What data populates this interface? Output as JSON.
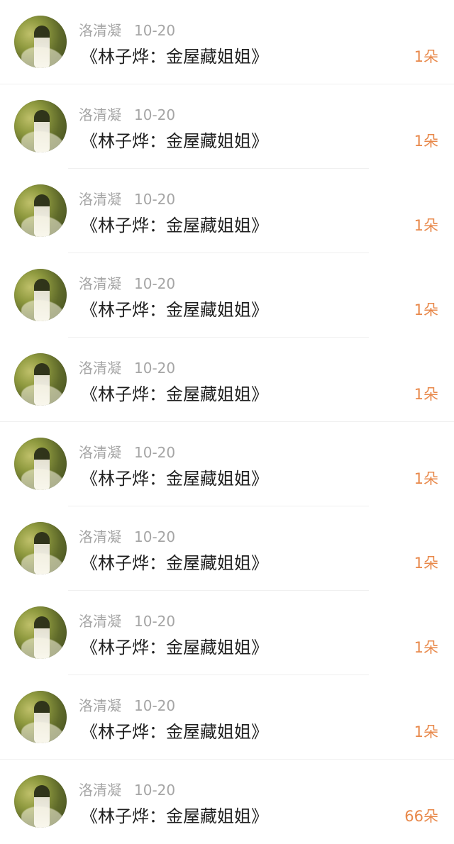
{
  "comments": [
    {
      "name": "洛清凝",
      "date": "10-20",
      "title": "《林子烨：金屋藏姐姐》",
      "count": "1朵",
      "avatar_icon": "avatar-photo"
    },
    {
      "name": "洛清凝",
      "date": "10-20",
      "title": "《林子烨：金屋藏姐姐》",
      "count": "1朵",
      "avatar_icon": "avatar-photo"
    },
    {
      "name": "洛清凝",
      "date": "10-20",
      "title": "《林子烨：金屋藏姐姐》",
      "count": "1朵",
      "avatar_icon": "avatar-photo"
    },
    {
      "name": "洛清凝",
      "date": "10-20",
      "title": "《林子烨：金屋藏姐姐》",
      "count": "1朵",
      "avatar_icon": "avatar-photo"
    },
    {
      "name": "洛清凝",
      "date": "10-20",
      "title": "《林子烨：金屋藏姐姐》",
      "count": "1朵",
      "avatar_icon": "avatar-photo"
    },
    {
      "name": "洛清凝",
      "date": "10-20",
      "title": "《林子烨：金屋藏姐姐》",
      "count": "1朵",
      "avatar_icon": "avatar-photo"
    },
    {
      "name": "洛清凝",
      "date": "10-20",
      "title": "《林子烨：金屋藏姐姐》",
      "count": "1朵",
      "avatar_icon": "avatar-photo"
    },
    {
      "name": "洛清凝",
      "date": "10-20",
      "title": "《林子烨：金屋藏姐姐》",
      "count": "1朵",
      "avatar_icon": "avatar-photo"
    },
    {
      "name": "洛清凝",
      "date": "10-20",
      "title": "《林子烨：金屋藏姐姐》",
      "count": "1朵",
      "avatar_icon": "avatar-photo"
    },
    {
      "name": "洛清凝",
      "date": "10-20",
      "title": "《林子烨：金屋藏姐姐》",
      "count": "66朵",
      "avatar_icon": "avatar-photo"
    }
  ],
  "colors": {
    "background": "#ffffff",
    "meta_text": "#a5a5a5",
    "title_text": "#1f1f1f",
    "count_text": "#e8884a"
  }
}
